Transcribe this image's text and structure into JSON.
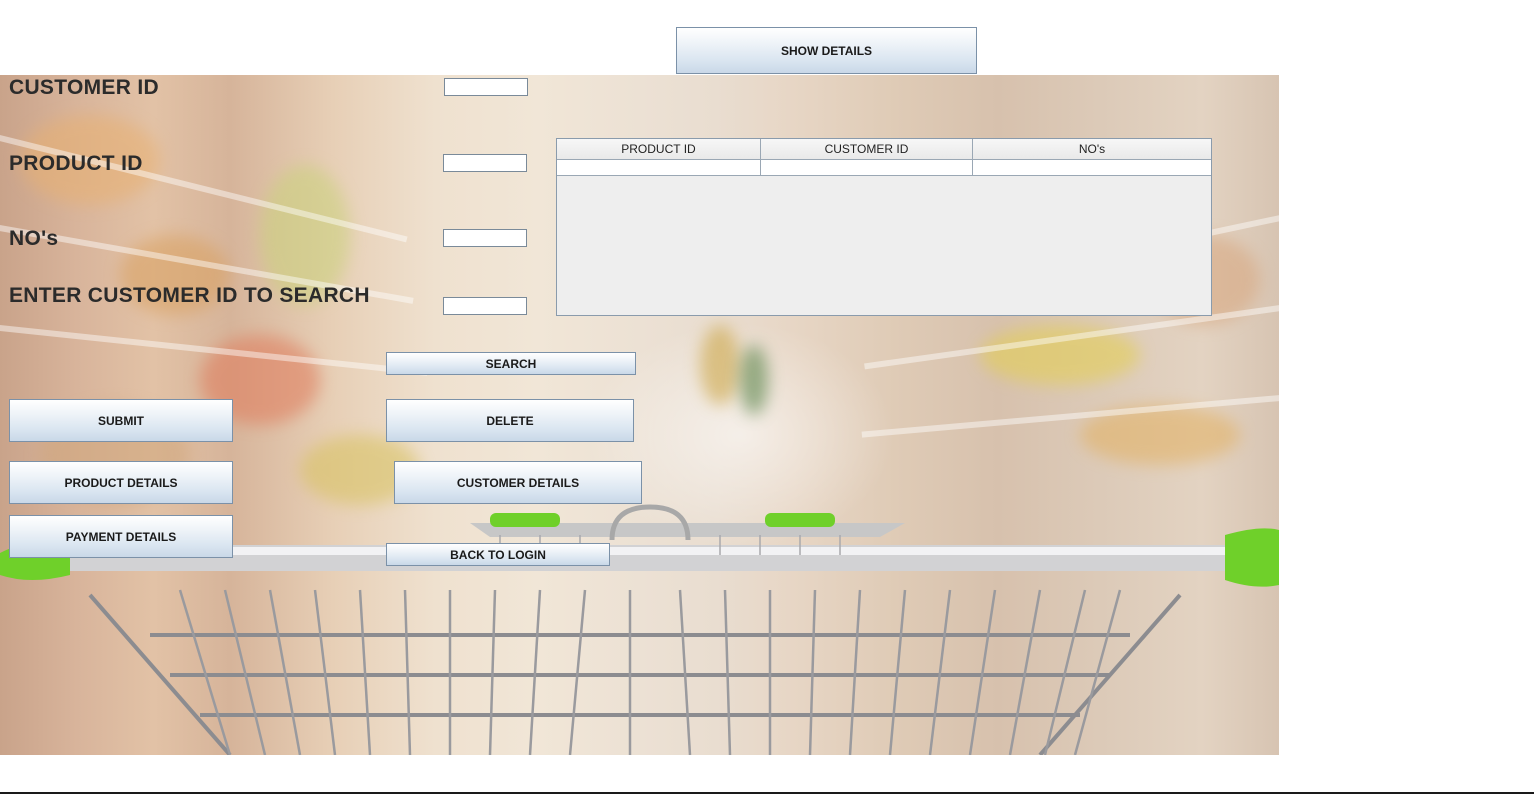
{
  "form": {
    "customer_id_label": "CUSTOMER ID",
    "product_id_label": "PRODUCT ID",
    "nos_label": "NO's",
    "search_label": "ENTER CUSTOMER ID TO SEARCH",
    "customer_id_value": "",
    "product_id_value": "",
    "nos_value": "",
    "search_value": ""
  },
  "buttons": {
    "show_details": "SHOW  DETAILS",
    "search": "SEARCH",
    "submit": "SUBMIT",
    "delete": "DELETE",
    "product_details": "PRODUCT DETAILS",
    "customer_details": "CUSTOMER DETAILS",
    "payment_details": "PAYMENT DETAILS",
    "back_to_login": "BACK TO LOGIN"
  },
  "table": {
    "columns": [
      "PRODUCT ID",
      "CUSTOMER ID",
      "NO's"
    ],
    "rows": [
      [
        "",
        "",
        ""
      ]
    ]
  },
  "colors": {
    "button_top": "#ffffff",
    "button_bottom": "#c9d8e8",
    "button_border": "#7b91a8",
    "label_text": "#2b2b2b",
    "cart_green": "#6fd02a"
  }
}
